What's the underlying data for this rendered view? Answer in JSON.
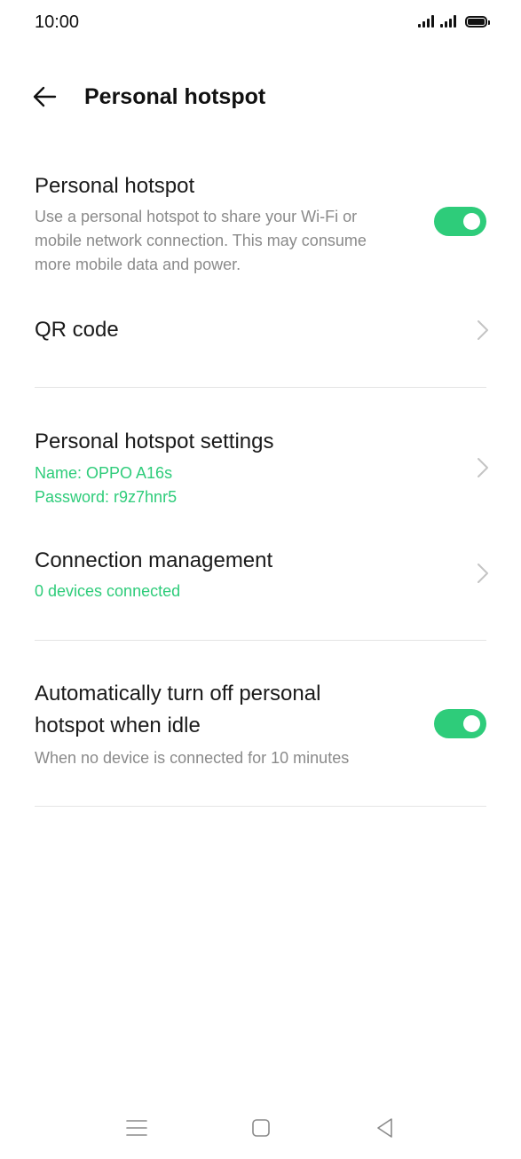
{
  "status_bar": {
    "time": "10:00",
    "icons": [
      "signal-icon",
      "signal-icon",
      "battery-icon"
    ]
  },
  "header": {
    "back_icon": "back-arrow-icon",
    "title": "Personal hotspot"
  },
  "hotspot": {
    "title": "Personal hotspot",
    "description_line1": "Use a personal hotspot to share your Wi-Fi or",
    "description_line2": "mobile network connection. This may consume",
    "description_line3": "more mobile data and power.",
    "enabled": true
  },
  "qr_code": {
    "label": "QR code",
    "icon": "chevron-right-icon"
  },
  "hotspot_settings": {
    "title": "Personal hotspot settings",
    "name_line": "Name: OPPO A16s",
    "password_line": "Password: r9z7hnr5",
    "icon": "chevron-right-icon"
  },
  "connection_management": {
    "title": "Connection management",
    "status": "0 devices connected",
    "icon": "chevron-right-icon"
  },
  "auto_off": {
    "title_line1": "Automatically turn off personal",
    "title_line2": "hotspot when idle",
    "description": "When no device is connected for 10 minutes",
    "enabled": true
  },
  "nav_bar": {
    "icons": [
      "menu-icon",
      "home-icon",
      "back-triangle-icon"
    ]
  },
  "colors": {
    "accent": "#2ecc7a",
    "text_primary": "#1a1a1a",
    "text_secondary": "#8a8a8a",
    "divider": "#e4e4e4"
  }
}
